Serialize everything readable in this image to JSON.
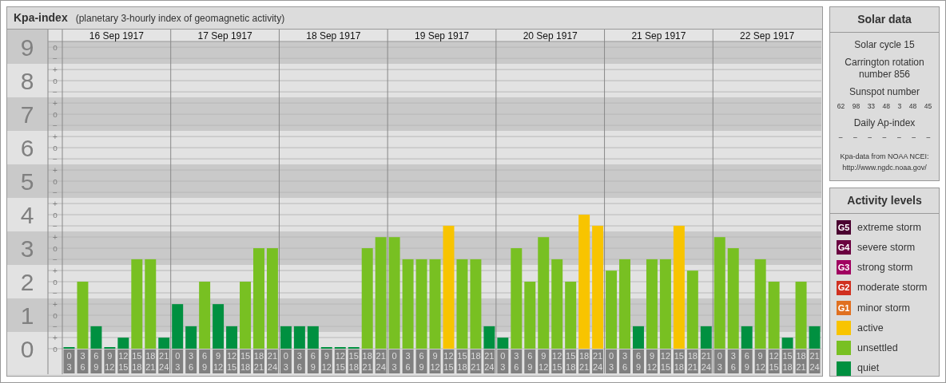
{
  "kpa_panel": {
    "title": "Kpa-index",
    "subtitle": "(planetary 3-hourly index of geomagnetic activity)",
    "sublevel_marks": [
      "o",
      "−",
      "+",
      "o",
      "−",
      "+",
      "o",
      "−",
      "+",
      "o",
      "−",
      "+",
      "o",
      "−",
      "+",
      "o",
      "−",
      "+",
      "o",
      "−",
      "+",
      "o",
      "−",
      "+",
      "o",
      "−",
      "+",
      "o"
    ],
    "days": [
      "16 Sep 1917",
      "17 Sep 1917",
      "18 Sep 1917",
      "19 Sep 1917",
      "20 Sep 1917",
      "21 Sep 1917",
      "22 Sep 1917"
    ],
    "chart_data": {
      "type": "bar",
      "grid": true,
      "ylim": [
        0,
        9.17
      ],
      "yticks": [
        0,
        1,
        2,
        3,
        4,
        5,
        6,
        7,
        8,
        9
      ],
      "categories": [
        "0 3",
        "3 6",
        "6 9",
        "9 12",
        "12 15",
        "15 18",
        "18 21",
        "21 24",
        "0 3",
        "3 6",
        "6 9",
        "9 12",
        "12 15",
        "15 18",
        "18 21",
        "21 24",
        "0 3",
        "3 6",
        "6 9",
        "9 12",
        "12 15",
        "15 18",
        "18 21",
        "21 24",
        "0 3",
        "3 6",
        "6 9",
        "9 12",
        "12 15",
        "15 18",
        "18 21",
        "21 24",
        "0 3",
        "3 6",
        "6 9",
        "9 12",
        "12 15",
        "15 18",
        "18 21",
        "21 24",
        "0 3",
        "3 6",
        "6 9",
        "9 12",
        "12 15",
        "15 18",
        "18 21",
        "21 24",
        "0 3",
        "3 6",
        "6 9",
        "9 12",
        "12 15",
        "15 18",
        "18 21",
        "21 24"
      ],
      "series": [
        {
          "color": "#f8c400",
          "values": [
            null,
            null,
            null,
            null,
            null,
            null,
            null,
            null,
            null,
            null,
            null,
            null,
            null,
            null,
            null,
            null,
            null,
            null,
            null,
            null,
            null,
            null,
            null,
            null,
            null,
            null,
            null,
            null,
            3.67,
            null,
            null,
            null,
            null,
            null,
            null,
            null,
            null,
            null,
            4,
            3.67,
            null,
            null,
            null,
            null,
            null,
            3.67,
            null,
            null,
            null,
            null,
            null,
            null,
            null,
            null,
            null,
            null
          ]
        },
        {
          "color": "#78c022",
          "values": [
            null,
            2,
            null,
            null,
            null,
            2.67,
            2.67,
            null,
            null,
            null,
            2,
            null,
            null,
            2,
            3,
            3,
            null,
            null,
            null,
            null,
            null,
            null,
            3,
            3.33,
            3.33,
            2.67,
            2.67,
            2.67,
            null,
            2.67,
            2.67,
            null,
            null,
            3,
            2,
            3.33,
            2.67,
            2,
            null,
            null,
            2.33,
            2.67,
            null,
            2.67,
            2.67,
            null,
            2.33,
            null,
            3.33,
            3,
            null,
            2.67,
            2,
            null,
            2,
            null
          ]
        },
        {
          "color": "#009040",
          "values": [
            0,
            null,
            0.67,
            0,
            0.33,
            null,
            null,
            0.33,
            1.33,
            0.67,
            null,
            1.33,
            0.67,
            null,
            null,
            null,
            0.67,
            0.67,
            0.67,
            0,
            0,
            0,
            null,
            null,
            null,
            null,
            null,
            null,
            null,
            null,
            null,
            0.67,
            0.33,
            null,
            null,
            null,
            null,
            null,
            null,
            null,
            null,
            null,
            0.67,
            null,
            null,
            null,
            null,
            0.67,
            null,
            null,
            0.67,
            null,
            null,
            0.33,
            null,
            0.67
          ]
        }
      ]
    }
  },
  "solar_panel": {
    "title": "Solar data",
    "solar_cycle": "Solar cycle 15",
    "carrington": "Carrington rotation number 856",
    "sunspot_heading": "Sunspot number",
    "sunspot_numbers": [
      "62",
      "98",
      "33",
      "48",
      "3",
      "48",
      "45"
    ],
    "ap_heading": "Daily Ap-index",
    "ap_values": [
      "–",
      "–",
      "–",
      "–",
      "–",
      "–",
      "–"
    ],
    "source": "Kpa-data from NOAA NCEI:",
    "source_url": "http://www.ngdc.noaa.gov/"
  },
  "activity_levels": {
    "title": "Activity levels",
    "items": [
      {
        "badge": "G5",
        "label": "extreme storm",
        "color": "#4a0030"
      },
      {
        "badge": "G4",
        "label": "severe storm",
        "color": "#6a0040"
      },
      {
        "badge": "G3",
        "label": "strong storm",
        "color": "#a00060"
      },
      {
        "badge": "G2",
        "label": "moderate storm",
        "color": "#d03020"
      },
      {
        "badge": "G1",
        "label": "minor storm",
        "color": "#e07020"
      },
      {
        "label": "active",
        "color": "#f8c400"
      },
      {
        "label": "unsettled",
        "color": "#78c022"
      },
      {
        "label": "quiet",
        "color": "#009040"
      }
    ]
  }
}
